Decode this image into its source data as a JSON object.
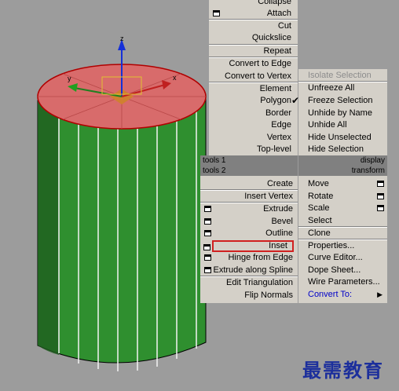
{
  "left_menu_top": [
    {
      "label": "Collapse",
      "icon": null
    },
    {
      "label": "Attach",
      "icon": "settings-box-icon"
    },
    {
      "label": "Cut",
      "icon": null
    },
    {
      "label": "Quickslice",
      "icon": null
    },
    {
      "label": "Repeat",
      "icon": null
    },
    {
      "label": "Convert to Edge",
      "icon": null
    },
    {
      "label": "Convert to Vertex",
      "icon": null
    },
    {
      "label": "Element",
      "icon": null
    },
    {
      "label": "Polygon",
      "icon": "checkmark-icon"
    },
    {
      "label": "Border",
      "icon": null
    },
    {
      "label": "Edge",
      "icon": null
    },
    {
      "label": "Vertex",
      "icon": null
    },
    {
      "label": "Top-level",
      "icon": null
    }
  ],
  "display_menu": [
    {
      "label": "Isolate Selection",
      "disabled": true
    },
    {
      "label": "Unfreeze All"
    },
    {
      "label": "Freeze Selection"
    },
    {
      "label": "Unhide by Name"
    },
    {
      "label": "Unhide All"
    },
    {
      "label": "Hide Unselected"
    },
    {
      "label": "Hide Selection"
    }
  ],
  "headers": {
    "tools1": "tools 1",
    "display": "display",
    "tools2": "tools 2",
    "transform": "transform"
  },
  "tools2_menu": [
    {
      "label": "Create",
      "icon": null
    },
    {
      "label": "Insert Vertex",
      "icon": null
    },
    {
      "label": "Extrude",
      "icon": "settings-box-icon"
    },
    {
      "label": "Bevel",
      "icon": "settings-box-icon"
    },
    {
      "label": "Outline",
      "icon": "settings-box-icon"
    },
    {
      "label": "Inset",
      "icon": "settings-box-icon"
    },
    {
      "label": "Hinge from Edge",
      "icon": "settings-box-icon"
    },
    {
      "label": "Extrude along Spline",
      "icon": "settings-box-icon"
    },
    {
      "label": "Edit Triangulation",
      "icon": null
    },
    {
      "label": "Flip Normals",
      "icon": null
    }
  ],
  "transform_menu": [
    {
      "label": "Move",
      "icon": "settings-box-icon"
    },
    {
      "label": "Rotate",
      "icon": "settings-box-icon"
    },
    {
      "label": "Scale",
      "icon": "settings-box-icon"
    },
    {
      "label": "Select",
      "icon": null
    },
    {
      "label": "Clone",
      "icon": null
    },
    {
      "label": "Properties...",
      "icon": null
    },
    {
      "label": "Curve Editor...",
      "icon": null
    },
    {
      "label": "Dope Sheet...",
      "icon": null
    },
    {
      "label": "Wire Parameters...",
      "icon": null
    },
    {
      "label": "Convert To:",
      "icon": "submenu-arrow-icon"
    }
  ],
  "gizmo_labels": {
    "z": "z",
    "y": "y",
    "x": "x"
  },
  "watermark": "最需教育",
  "colors": {
    "viewport_bg": "#9c9c9c",
    "menu_bg": "#d4d0c8",
    "cylinder_green": "#2f8f2f",
    "cap_red": "#d86b6b",
    "highlight_red": "#d02020",
    "convert_to": "#0000c8"
  }
}
